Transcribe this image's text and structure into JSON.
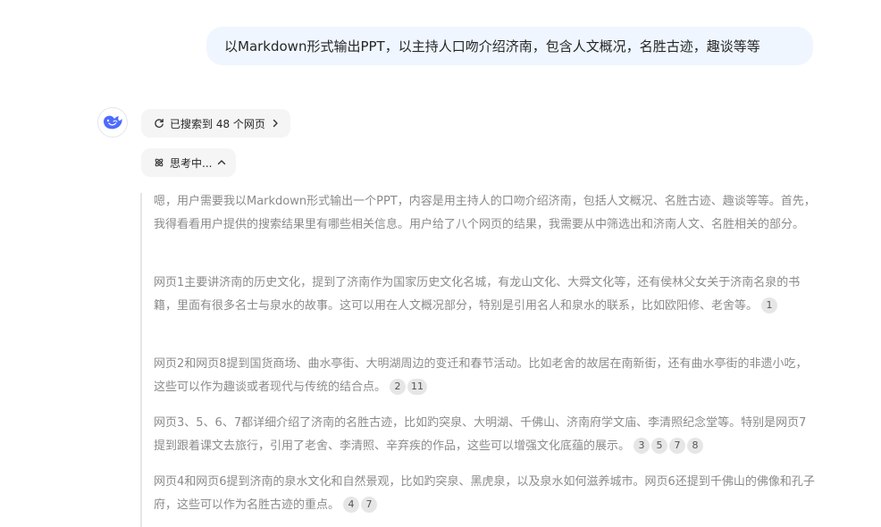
{
  "user_message": "以Markdown形式输出PPT，以主持人口吻介绍济南，包含人文概况，名胜古迹，趣谈等等",
  "search_status": {
    "label": "已搜索到 48 个网页"
  },
  "thinking_status": {
    "label": "思考中..."
  },
  "thought_paragraphs": [
    {
      "text": "嗯，用户需要我以Markdown形式输出一个PPT，内容是用主持人的口吻介绍济南，包括人文概况、名胜古迹、趣谈等等。首先，我得看看用户提供的搜索结果里有哪些相关信息。用户给了八个网页的结果，我需要从中筛选出和济南人文、名胜相关的部分。",
      "citations": []
    },
    {
      "text": "网页1主要讲济南的历史文化，提到了济南作为国家历史文化名城，有龙山文化、大舜文化等，还有侯林父女关于济南名泉的书籍，里面有很多名士与泉水的故事。这可以用在人文概况部分，特别是引用名人和泉水的联系，比如欧阳修、老舍等。",
      "citations": [
        "1"
      ]
    },
    {
      "text": "网页2和网页8提到国货商场、曲水亭街、大明湖周边的变迁和春节活动。比如老舍的故居在南新街，还有曲水亭街的非遗小吃，这些可以作为趣谈或者现代与传统的结合点。",
      "citations": [
        "2",
        "11"
      ]
    },
    {
      "text": "网页3、5、6、7都详细介绍了济南的名胜古迹，比如趵突泉、大明湖、千佛山、济南府学文庙、李清照纪念堂等。特别是网页7提到跟着课文去旅行，引用了老舍、李清照、辛弃疾的作品，这些可以增强文化底蕴的展示。",
      "citations": [
        "3",
        "5",
        "7",
        "8"
      ]
    },
    {
      "text": "网页4和网页6提到济南的泉水文化和自然景观，比如趵突泉、黑虎泉，以及泉水如何滋养城市。网页6还提到千佛山的佛像和孔子府，这些可以作为名胜古迹的重点。",
      "citations": [
        "4",
        "7"
      ]
    }
  ]
}
